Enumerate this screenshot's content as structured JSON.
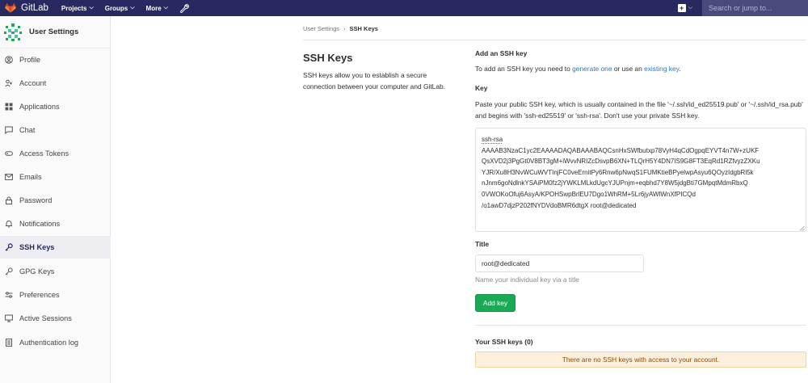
{
  "navbar": {
    "brand": "GitLab",
    "links": [
      {
        "label": "Projects"
      },
      {
        "label": "Groups"
      },
      {
        "label": "More"
      }
    ],
    "search_placeholder": "Search or jump to...",
    "bg_color": "#292961"
  },
  "sidebar": {
    "title": "User Settings",
    "items": [
      {
        "label": "Profile",
        "icon": "profile-icon"
      },
      {
        "label": "Account",
        "icon": "account-icon"
      },
      {
        "label": "Applications",
        "icon": "applications-icon"
      },
      {
        "label": "Chat",
        "icon": "chat-icon"
      },
      {
        "label": "Access Tokens",
        "icon": "token-icon"
      },
      {
        "label": "Emails",
        "icon": "email-icon"
      },
      {
        "label": "Password",
        "icon": "lock-icon"
      },
      {
        "label": "Notifications",
        "icon": "bell-icon"
      },
      {
        "label": "SSH Keys",
        "icon": "key-icon",
        "active": true
      },
      {
        "label": "GPG Keys",
        "icon": "key-icon"
      },
      {
        "label": "Preferences",
        "icon": "sliders-icon"
      },
      {
        "label": "Active Sessions",
        "icon": "monitor-icon"
      },
      {
        "label": "Authentication log",
        "icon": "log-icon"
      }
    ]
  },
  "breadcrumb": {
    "parent": "User Settings",
    "current": "SSH Keys"
  },
  "intro": {
    "title": "SSH Keys",
    "description": "SSH keys allow you to establish a secure connection between your computer and GitLab."
  },
  "form": {
    "add_heading": "Add an SSH key",
    "add_text_before": "To add an SSH key you need to ",
    "generate_link": "generate one",
    "add_text_mid": " or use an ",
    "existing_link": "existing key",
    "add_text_after": ".",
    "key_label": "Key",
    "key_help": "Paste your public SSH key, which is usually contained in the file '~/.ssh/id_ed25519.pub' or '~/.ssh/id_rsa.pub' and begins with 'ssh-ed25519' or 'ssh-rsa'. Don't use your private SSH key.",
    "key_prefix": "ssh-rsa",
    "key_lines": [
      "AAAAB3NzaC1yc2EAAAADAQABAAABAQCsnHxSWfbutxp78VyH4qCdOgpqEYVT4n7W+zUKF",
      "QsXVD2j3PgGt0V8BT3gM+iWvvNRIZcDsvpB6XN+TLQrH5Y4DN7IS9G8FT3EqRd1RZfvyzZXKu",
      "YJR/Xu8H3NvWCuWVTInjFC0veErnitPy6Rnw6pNwqS1FUMKtieBPyelwpAsyu6QOyzIdgbRl5k",
      "nJnm6goNdlnkYSAiPM0fz2jYWKLMLkdUgcYJUPnjm+eqbhd7Y8W5jdgBti7GMpqtMdmRbxQ",
      "0VWOKoOfuj6AsyA/KPOHSwpBrlEU7Dgo1WhRM+5Lr6jyAWlWnXfPICQd",
      "/o1awD7djzP202fNYDVdoBMR6dtgX root@dedicated"
    ],
    "title_label": "Title",
    "title_value": "root@dedicated",
    "title_help": "Name your individual key via a title",
    "submit_label": "Add key"
  },
  "keys_list": {
    "heading": "Your SSH keys (0)",
    "empty_message": "There are no SSH keys with access to your account."
  },
  "colors": {
    "accent": "#1aaa55",
    "link": "#1f78d1",
    "warning_bg": "#fdf1dd"
  }
}
